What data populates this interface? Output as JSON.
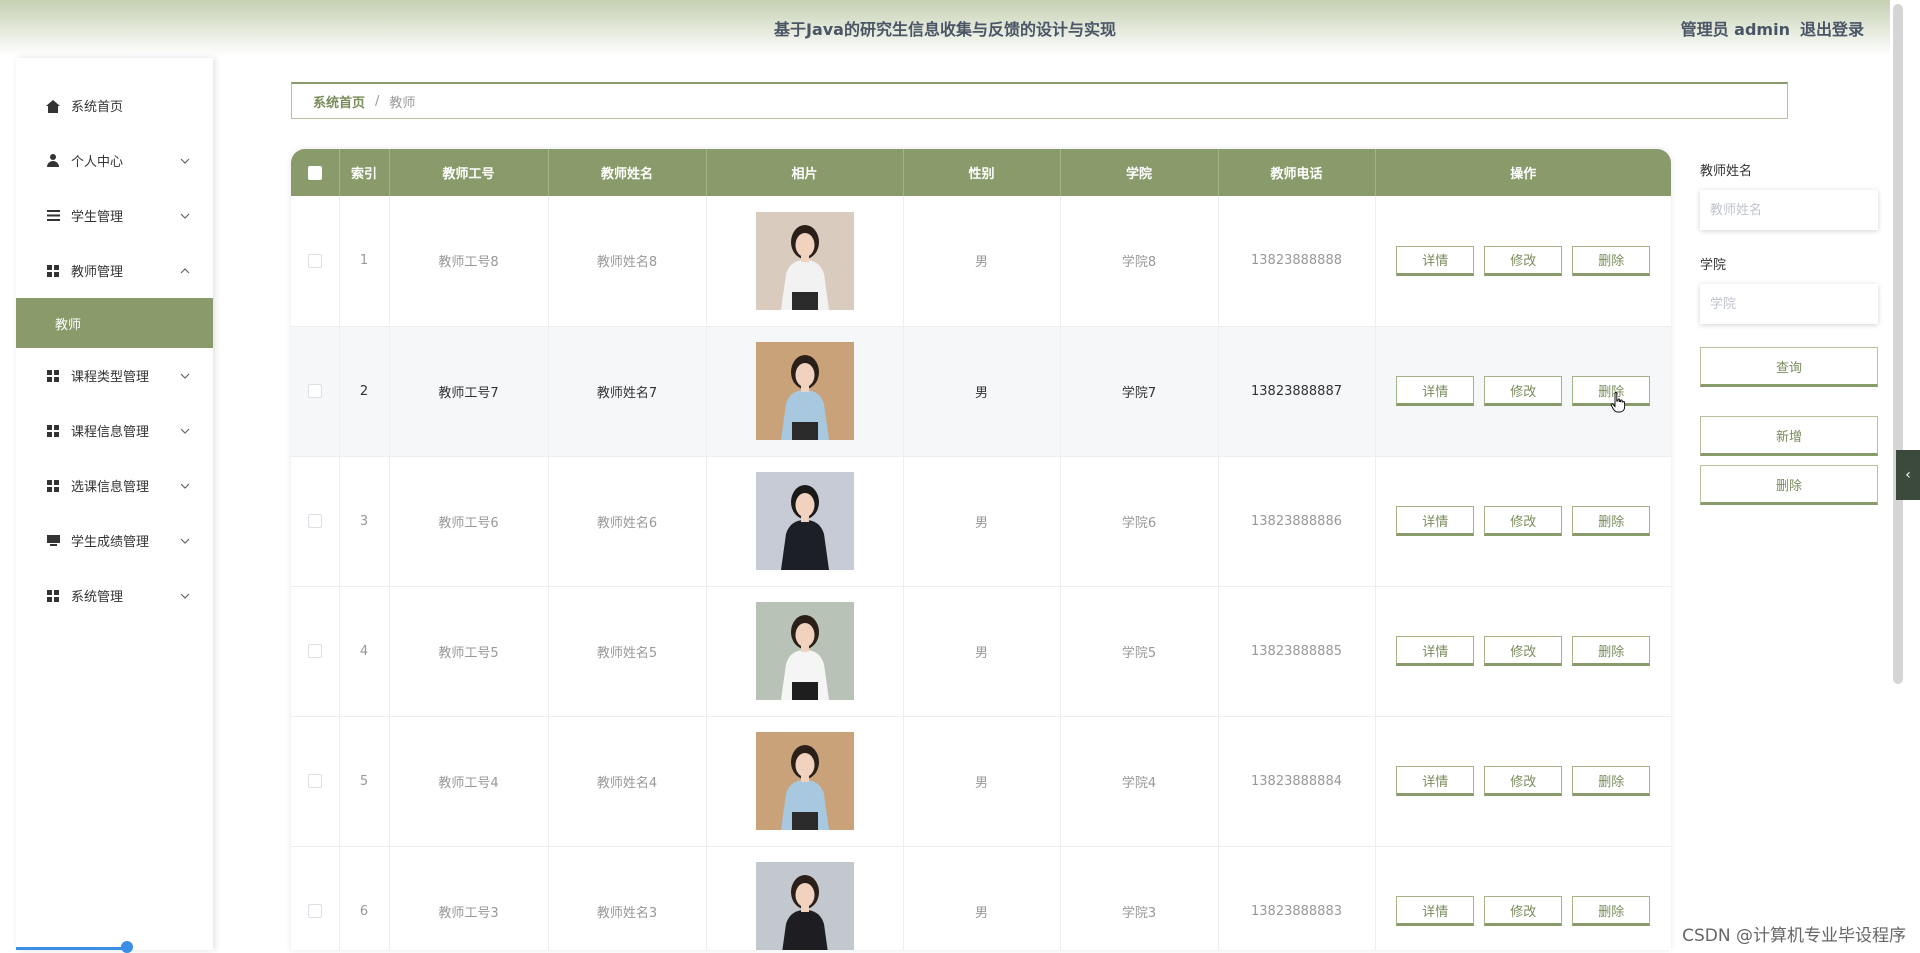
{
  "header": {
    "title": "基于Java的研究生信息收集与反馈的设计与实现",
    "user_label": "管理员 admin",
    "logout_label": "退出登录"
  },
  "sidebar": {
    "items": [
      {
        "label": "系统首页",
        "icon": "home-icon"
      },
      {
        "label": "个人中心",
        "icon": "user-icon",
        "expanded": false
      },
      {
        "label": "学生管理",
        "icon": "list-icon",
        "expanded": false
      },
      {
        "label": "教师管理",
        "icon": "grid-icon",
        "expanded": true
      },
      {
        "label": "课程类型管理",
        "icon": "grid-icon",
        "expanded": false
      },
      {
        "label": "课程信息管理",
        "icon": "grid-icon",
        "expanded": false
      },
      {
        "label": "选课信息管理",
        "icon": "grid-icon",
        "expanded": false
      },
      {
        "label": "学生成绩管理",
        "icon": "monitor-icon",
        "expanded": false
      },
      {
        "label": "系统管理",
        "icon": "grid-icon",
        "expanded": false
      }
    ],
    "sub_item": {
      "label": "教师"
    }
  },
  "breadcrumb": {
    "home": "系统首页",
    "separator": "/",
    "current": "教师"
  },
  "table": {
    "columns": [
      "索引",
      "教师工号",
      "教师姓名",
      "相片",
      "性别",
      "学院",
      "教师电话",
      "操作"
    ],
    "actions": {
      "detail": "详情",
      "edit": "修改",
      "delete": "删除"
    },
    "rows": [
      {
        "index": "1",
        "teacher_no": "教师工号8",
        "name": "教师姓名8",
        "gender": "男",
        "college": "学院8",
        "phone": "13823888888",
        "photo": {
          "bg": "#d9ccbf",
          "top": "#f2f2f2",
          "bottom": "#2a2a2a",
          "hair": "#2b2019"
        }
      },
      {
        "index": "2",
        "teacher_no": "教师工号7",
        "name": "教师姓名7",
        "gender": "男",
        "college": "学院7",
        "phone": "13823888887",
        "photo": {
          "bg": "#c9a27a",
          "top": "#a8c8e0",
          "bottom": "#2a2a2a",
          "hair": "#2b2019"
        }
      },
      {
        "index": "3",
        "teacher_no": "教师工号6",
        "name": "教师姓名6",
        "gender": "男",
        "college": "学院6",
        "phone": "13823888886",
        "photo": {
          "bg": "#c6cbd6",
          "top": "#1c1f26",
          "bottom": "#1c1f26",
          "hair": "#1a1a1a"
        }
      },
      {
        "index": "4",
        "teacher_no": "教师工号5",
        "name": "教师姓名5",
        "gender": "男",
        "college": "学院5",
        "phone": "13823888885",
        "photo": {
          "bg": "#b9c2b6",
          "top": "#f5f5f5",
          "bottom": "#1e1e1e",
          "hair": "#2b2019"
        }
      },
      {
        "index": "5",
        "teacher_no": "教师工号4",
        "name": "教师姓名4",
        "gender": "男",
        "college": "学院4",
        "phone": "13823888884",
        "photo": {
          "bg": "#c9a27a",
          "top": "#a8c8e0",
          "bottom": "#2a2a2a",
          "hair": "#2b2019"
        }
      },
      {
        "index": "6",
        "teacher_no": "教师工号3",
        "name": "教师姓名3",
        "gender": "男",
        "college": "学院3",
        "phone": "13823888883",
        "photo": {
          "bg": "#c3c7ce",
          "top": "#1d1d22",
          "bottom": "#1d1d22",
          "hair": "#2b2019"
        }
      }
    ]
  },
  "search": {
    "name_label": "教师姓名",
    "name_placeholder": "教师姓名",
    "college_label": "学院",
    "college_placeholder": "学院",
    "query_label": "查询",
    "add_label": "新增",
    "delete_label": "删除"
  },
  "side_tab": {
    "label": "‹"
  },
  "watermark": "CSDN @计算机专业毕设程序",
  "colors": {
    "accent": "#899a6b",
    "accent_text": "#7a8c5c",
    "header_text": "#4a5666"
  }
}
